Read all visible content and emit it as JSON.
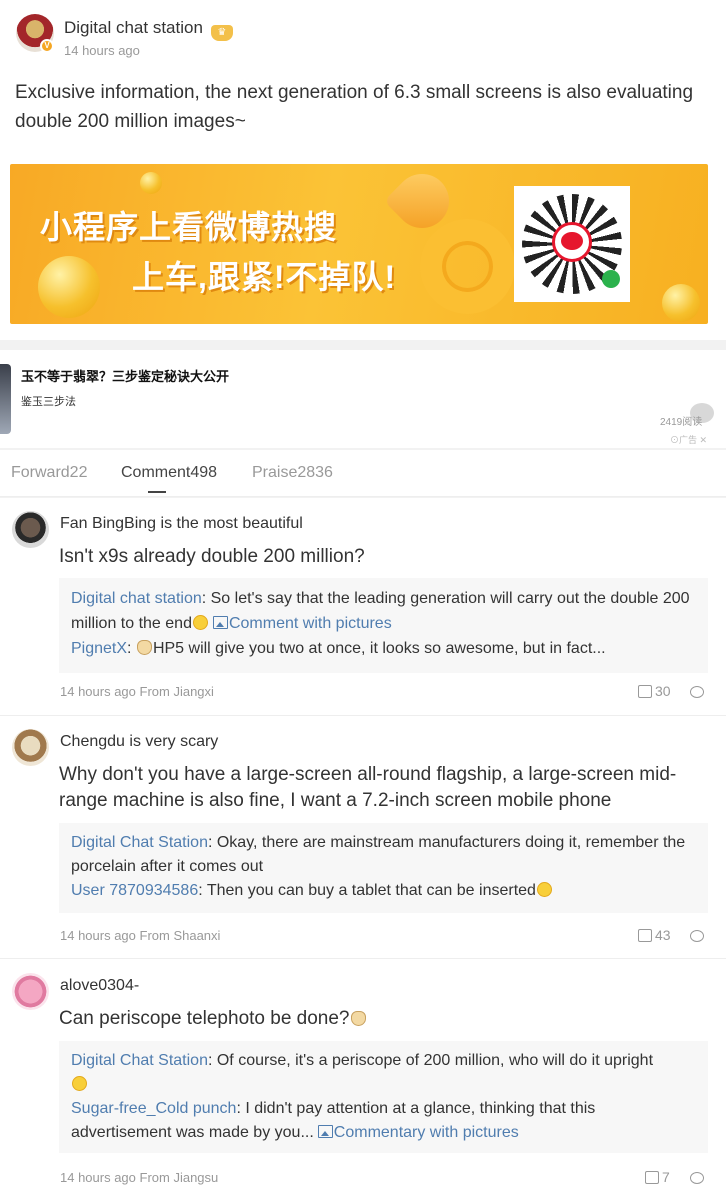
{
  "post": {
    "author": "Digital chat station",
    "badge": "V",
    "time": "14 hours ago",
    "text": "Exclusive information, the next generation of 6.3 small screens is also evaluating double 200 million images~",
    "banner_line1": "小程序上看微博热搜",
    "banner_line2": "上车,跟紧!不掉队!"
  },
  "ad": {
    "title": "玉不等于翡翠？三步鉴定秘诀大公开",
    "subtitle": "鉴玉三步法",
    "reads": "2419阅读",
    "tag": "广告"
  },
  "tabs": {
    "forward": "Forward22",
    "comment": "Comment498",
    "praise": "Praise2836"
  },
  "comments": [
    {
      "name": "Fan BingBing is the most beautiful",
      "text": "Isn't x9s already double 200 million?",
      "reply1_name": "Digital chat station",
      "reply1_text": ": So let's say that the leading generation will carry out the double 200 million to the end",
      "reply1_link": "Comment with pictures",
      "reply2_name": "PignetX",
      "reply2_text": "HP5 will give you two at once, it looks so awesome, but in fact...",
      "meta": "14 hours ago From Jiangxi",
      "likes": "30"
    },
    {
      "name": "Chengdu is very scary",
      "text": "Why don't you have a large-screen all-round flagship, a large-screen mid-range machine is also fine, I want a 7.2-inch screen mobile phone",
      "reply1_name": "Digital Chat Station",
      "reply1_text": ": Okay, there are mainstream manufacturers doing it, remember the porcelain after it comes out",
      "reply2_name": "User 7870934586",
      "reply2_text": ": Then you can buy a tablet that can be inserted",
      "meta": "14 hours ago From Shaanxi",
      "likes": "43"
    },
    {
      "name": "alove0304-",
      "text": "Can periscope telephoto be done?",
      "reply1_name": "Digital Chat Station",
      "reply1_text": ": Of course, it's a periscope of 200 million, who will do it upright",
      "reply2_name": "Sugar-free_Cold punch",
      "reply2_text": ": I didn't pay attention at a glance, thinking that this advertisement was made by you...",
      "reply2_link": "Commentary with pictures",
      "meta": "14 hours ago From Jiangsu",
      "likes": "7"
    }
  ]
}
